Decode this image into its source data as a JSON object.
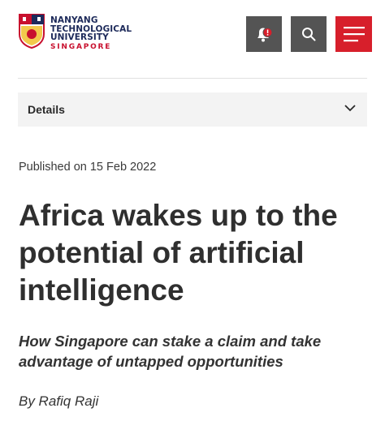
{
  "header": {
    "logo": {
      "line1": "NANYANG",
      "line2": "TECHNOLOGICAL",
      "line3": "UNIVERSITY",
      "line4": "SINGAPORE"
    },
    "alert_icon": "bell-alert-icon",
    "search_icon": "search-icon",
    "menu_icon": "hamburger-menu-icon"
  },
  "details": {
    "label": "Details",
    "chevron_icon": "chevron-down-icon"
  },
  "article": {
    "published": "Published on 15 Feb 2022",
    "title": "Africa wakes up to the potential of artificial intelligence",
    "subtitle": "How Singapore can stake a claim and take advantage of untapped opportunities",
    "byline": "By Rafiq Raji"
  },
  "colors": {
    "brand_red": "#d71f2b",
    "button_grey": "#545454",
    "brand_navy": "#1d2a5a"
  }
}
